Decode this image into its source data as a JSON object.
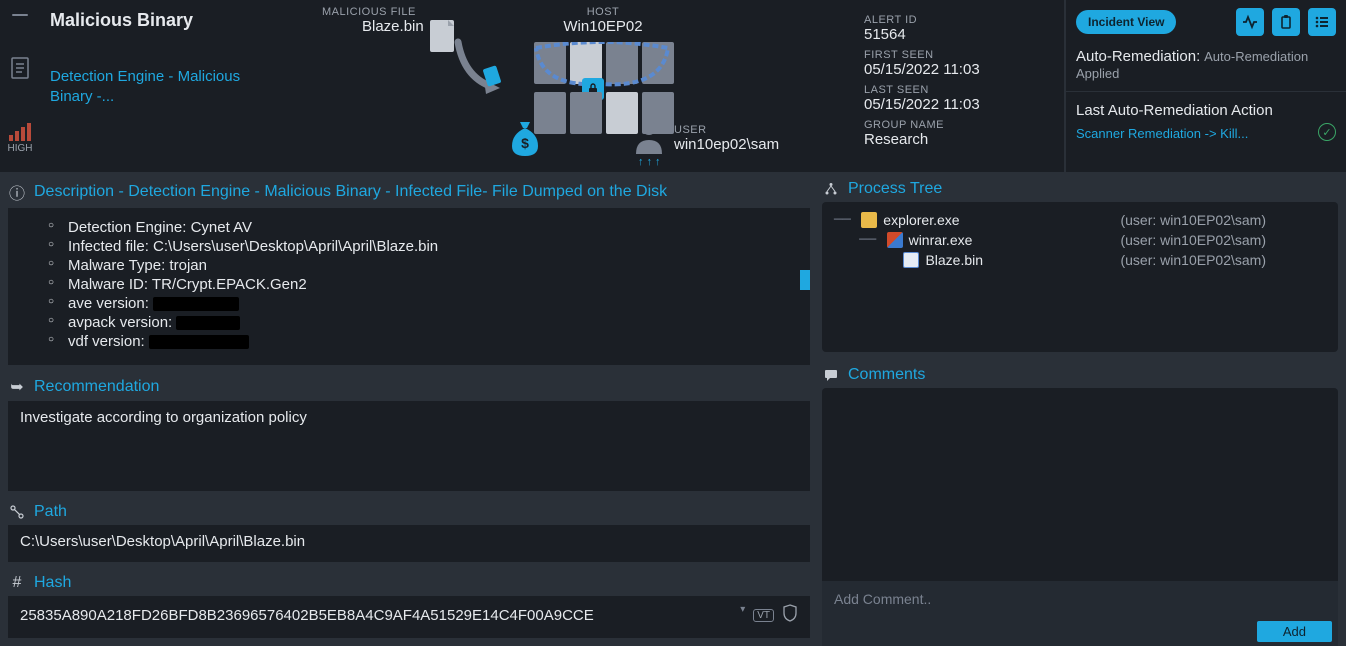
{
  "header": {
    "title": "Malicious Binary",
    "subtitle": "Detection Engine - Malicious Binary -...",
    "severity": "HIGH"
  },
  "graph": {
    "mal_file_label": "MALICIOUS FILE",
    "mal_file_value": "Blaze.bin",
    "host_label": "HOST",
    "host_value": "Win10EP02",
    "user_label": "USER",
    "user_value": "win10ep02\\sam"
  },
  "meta": {
    "alert_id_label": "ALERT ID",
    "alert_id": "51564",
    "first_seen_label": "FIRST SEEN",
    "first_seen": "05/15/2022 11:03",
    "last_seen_label": "LAST SEEN",
    "last_seen": "05/15/2022 11:03",
    "group_label": "GROUP NAME",
    "group": "Research"
  },
  "action": {
    "incident_button": "Incident View",
    "auto_rem_title": "Auto-Remediation:",
    "auto_rem_status": "Auto-Remediation Applied",
    "last_action_title": "Last Auto-Remediation Action",
    "last_action_link": "Scanner Remediation -> Kill..."
  },
  "description": {
    "heading": "Description - Detection Engine - Malicious Binary - Infected File- File Dumped on the Disk",
    "items": {
      "engine": "Detection Engine: Cynet AV",
      "infected": "Infected file: C:\\Users\\user\\Desktop\\April\\April\\Blaze.bin",
      "mtype": "Malware Type: trojan",
      "mid": "Malware ID: TR/Crypt.EPACK.Gen2",
      "ave": "ave version: ",
      "avpack": "avpack version: ",
      "vdf": "vdf version: "
    }
  },
  "recommendation": {
    "heading": "Recommendation",
    "text": "Investigate according to organization policy"
  },
  "path": {
    "heading": "Path",
    "value": "C:\\Users\\user\\Desktop\\April\\April\\Blaze.bin"
  },
  "hash": {
    "heading": "Hash",
    "value": "25835A890A218FD26BFD8B23696576402B5EB8A4C9AF4A51529E14C4F00A9CCE"
  },
  "tree": {
    "heading": "Process Tree",
    "rows": [
      {
        "indent": "── ",
        "icon": "ic-folder",
        "name": "explorer.exe",
        "user": "(user: win10EP02\\sam)"
      },
      {
        "indent": "   ── ",
        "icon": "ic-rar",
        "name": "winrar.exe",
        "user": "(user: win10EP02\\sam)"
      },
      {
        "indent": "        ",
        "icon": "ic-bin",
        "name": "Blaze.bin",
        "user": "(user: win10EP02\\sam)"
      }
    ]
  },
  "comments": {
    "heading": "Comments",
    "placeholder": "Add Comment..",
    "add_button": "Add"
  }
}
